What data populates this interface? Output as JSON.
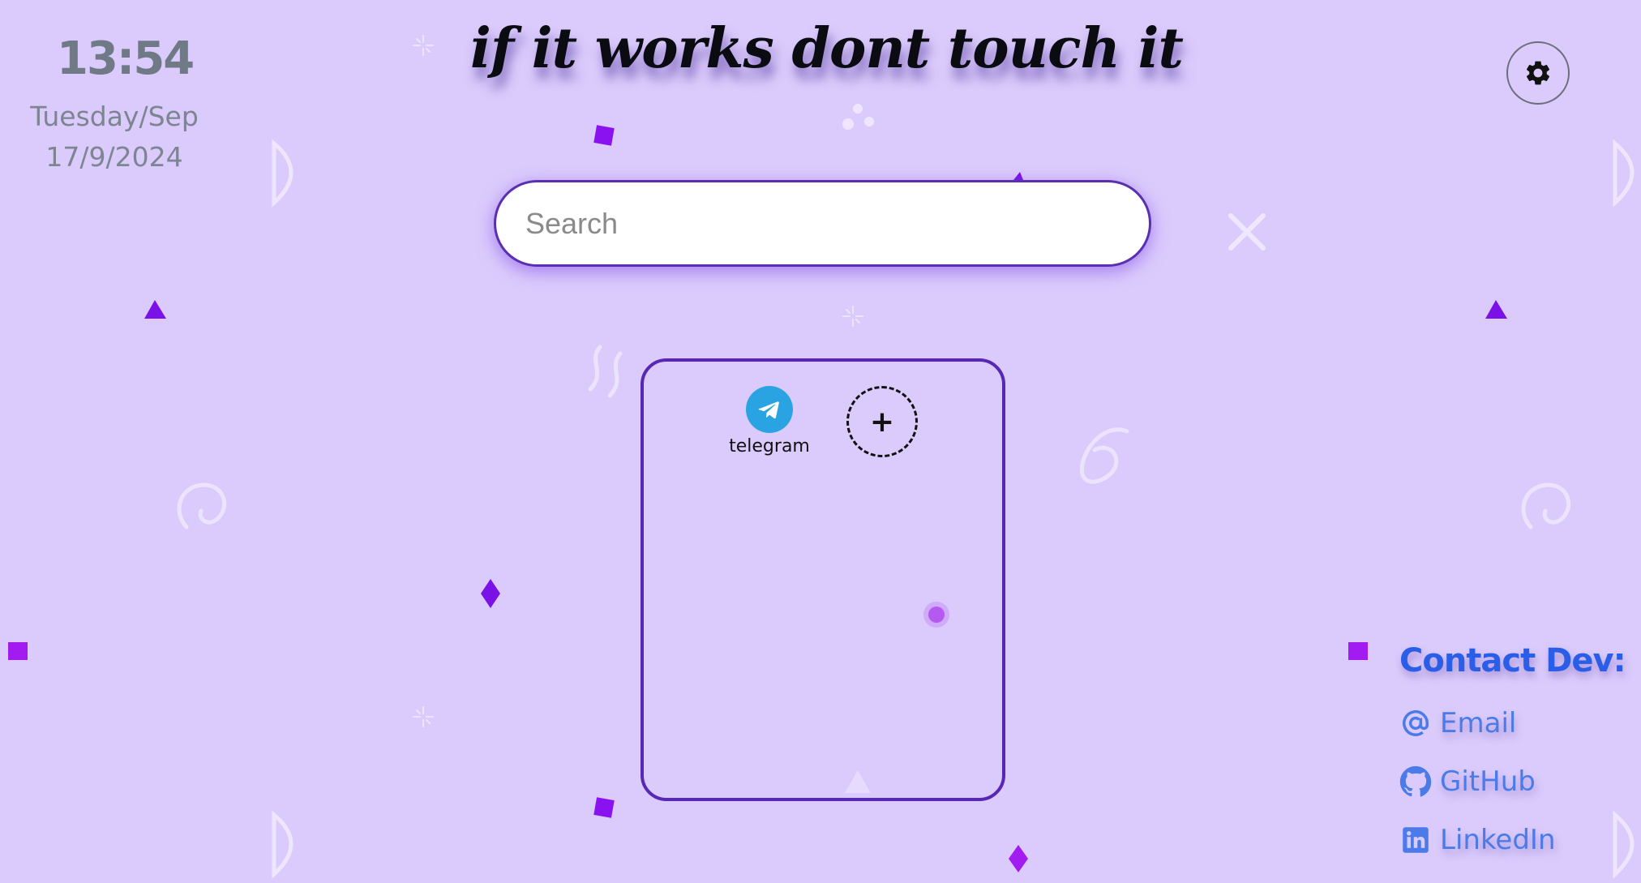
{
  "clock": {
    "time": "13:54",
    "day_month": "Tuesday/Sep",
    "date": "17/9/2024"
  },
  "header": {
    "motto": "if it works dont touch it"
  },
  "settings": {
    "icon": "gear-icon"
  },
  "search": {
    "placeholder": "Search",
    "value": ""
  },
  "apps": {
    "items": [
      {
        "label": "telegram",
        "icon": "telegram-icon"
      }
    ],
    "add_label": "+"
  },
  "contact": {
    "title": "Contact Dev:",
    "links": [
      {
        "label": "Email",
        "icon": "at-icon"
      },
      {
        "label": "GitHub",
        "icon": "github-icon"
      },
      {
        "label": "LinkedIn",
        "icon": "linkedin-icon"
      }
    ]
  },
  "colors": {
    "background": "#dbcbfc",
    "accent": "#5827b3",
    "link": "#4a7be8",
    "telegram": "#2aa3e3"
  }
}
